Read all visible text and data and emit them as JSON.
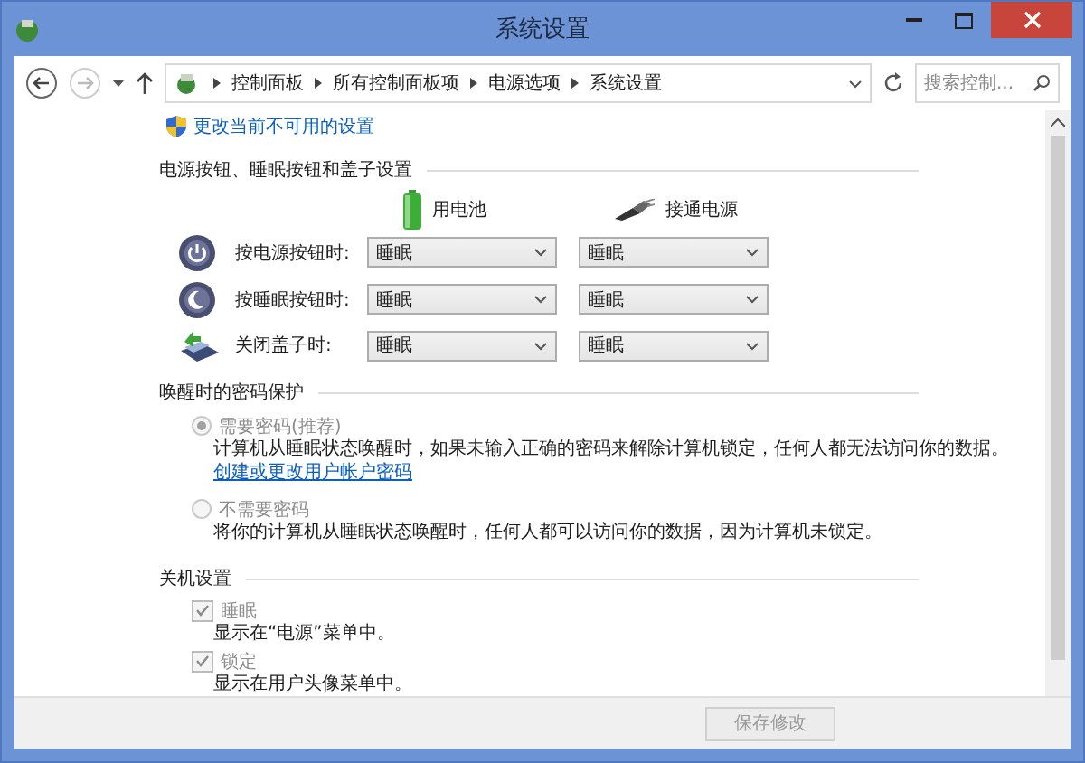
{
  "window": {
    "title": "系统设置"
  },
  "address_bar": {
    "breadcrumbs": [
      "控制面板",
      "所有控制面板项",
      "电源选项",
      "系统设置"
    ],
    "search_placeholder": "搜索控制..."
  },
  "admin_link": "更改当前不可用的设置",
  "power_section": {
    "title": "电源按钮、睡眠按钮和盖子设置",
    "columns": [
      "用电池",
      "接通电源"
    ],
    "rows": [
      {
        "kind": "power",
        "label": "按电源按钮时:",
        "battery": "睡眠",
        "plugged": "睡眠"
      },
      {
        "kind": "sleep",
        "label": "按睡眠按钮时:",
        "battery": "睡眠",
        "plugged": "睡眠"
      },
      {
        "kind": "lid",
        "label": "关闭盖子时:",
        "battery": "睡眠",
        "plugged": "睡眠"
      }
    ]
  },
  "password_section": {
    "title": "唤醒时的密码保护",
    "options": [
      {
        "label": "需要密码(推荐)",
        "selected": true,
        "disabled": true,
        "description": "计算机从睡眠状态唤醒时，如果未输入正确的密码来解除计算机锁定，任何人都无法访问你的数据。",
        "link": "创建或更改用户帐户密码"
      },
      {
        "label": "不需要密码",
        "selected": false,
        "disabled": true,
        "description": "将你的计算机从睡眠状态唤醒时，任何人都可以访问你的数据，因为计算机未锁定。"
      }
    ]
  },
  "shutdown_section": {
    "title": "关机设置",
    "options": [
      {
        "label": "睡眠",
        "checked": true,
        "disabled": true,
        "description": "显示在“电源”菜单中。"
      },
      {
        "label": "锁定",
        "checked": true,
        "disabled": true,
        "description": "显示在用户头像菜单中。"
      }
    ]
  },
  "footer": {
    "save_button": {
      "label": "保存修改",
      "disabled": true
    }
  }
}
